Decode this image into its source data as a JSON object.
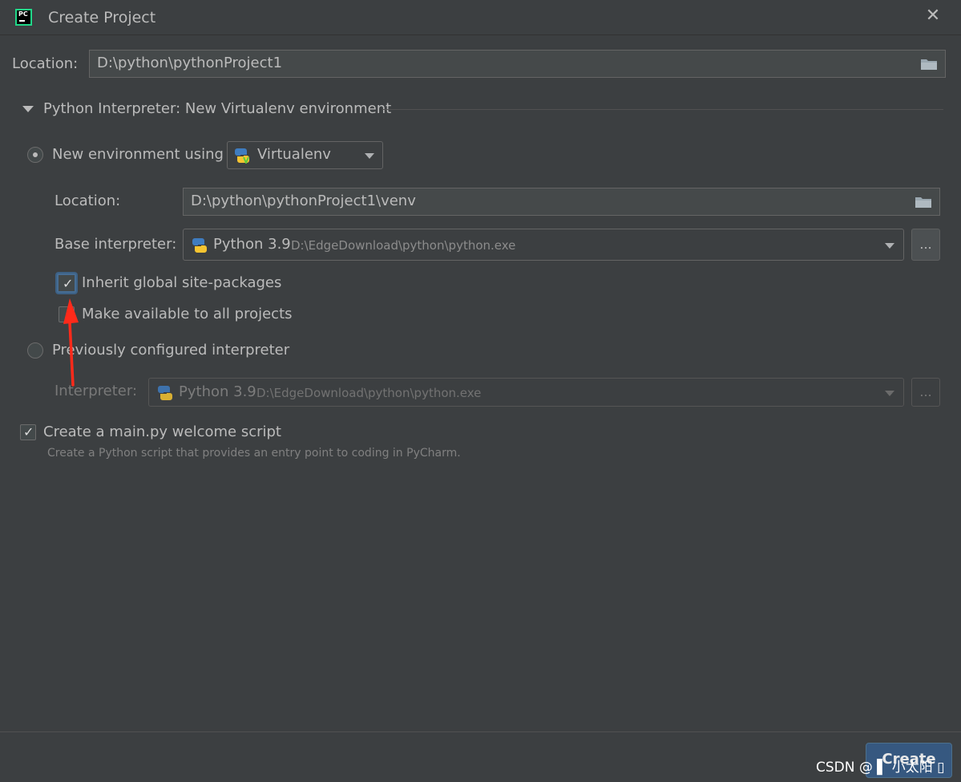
{
  "window": {
    "title": "Create Project",
    "close_label": "✕"
  },
  "project": {
    "location_label": "Location:",
    "location_value": "D:\\python\\pythonProject1"
  },
  "interpreter_section": {
    "title": "Python Interpreter: New Virtualenv environment",
    "expanded": true
  },
  "new_env": {
    "radio_label": "New environment using",
    "selected": true,
    "tool": "Virtualenv",
    "location_label": "Location:",
    "location_value": "D:\\python\\pythonProject1\\venv",
    "base_label": "Base interpreter:",
    "base_name": "Python 3.9",
    "base_path": "D:\\EdgeDownload\\python\\python.exe",
    "browse_label": "...",
    "inherit_label": "Inherit global site-packages",
    "inherit_checked": true,
    "make_available_label": "Make available to all projects",
    "make_available_checked": false
  },
  "existing": {
    "radio_label": "Previously configured interpreter",
    "selected": false,
    "interpreter_label": "Interpreter:",
    "interpreter_name": "Python 3.9",
    "interpreter_path": "D:\\EdgeDownload\\python\\python.exe",
    "browse_label": "..."
  },
  "welcome": {
    "label": "Create a main.py welcome script",
    "checked": true,
    "hint": "Create a Python script that provides an entry point to coding in PyCharm."
  },
  "footer": {
    "create_label": "Create",
    "watermark": "CSDN @ ▌ 小太阳 ▯"
  },
  "colors": {
    "background": "#3c3f41",
    "field": "#45494a",
    "accent": "#365880",
    "annotation_arrow": "#ff2a1a"
  },
  "icons": {
    "app": "pycharm-icon",
    "folder": "folder-icon",
    "python": "python-icon",
    "virtualenv": "virtualenv-icon"
  }
}
